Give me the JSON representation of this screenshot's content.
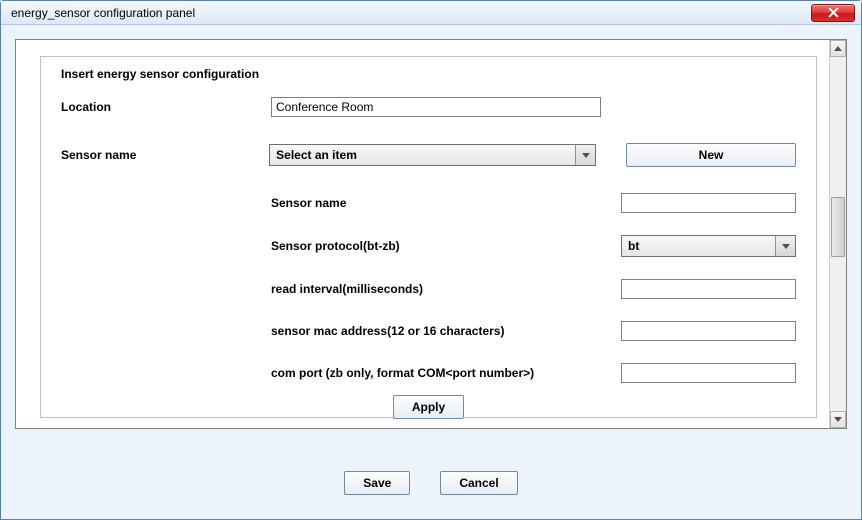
{
  "window": {
    "title": "energy_sensor configuration panel"
  },
  "heading": "Insert energy sensor configuration",
  "location": {
    "label": "Location",
    "value": "Conference Room"
  },
  "sensor_select": {
    "label": "Sensor name",
    "selected": "Select an item",
    "new_label": "New"
  },
  "details": {
    "name": {
      "label": "Sensor name",
      "value": ""
    },
    "protocol": {
      "label": "Sensor protocol(bt-zb)",
      "value": "bt"
    },
    "interval": {
      "label": "read interval(milliseconds)",
      "value": ""
    },
    "mac": {
      "label": "sensor mac address(12 or 16 characters)",
      "value": ""
    },
    "comport": {
      "label": "com port (zb only, format COM<port number>)",
      "value": ""
    }
  },
  "buttons": {
    "apply": "Apply",
    "save": "Save",
    "cancel": "Cancel"
  }
}
